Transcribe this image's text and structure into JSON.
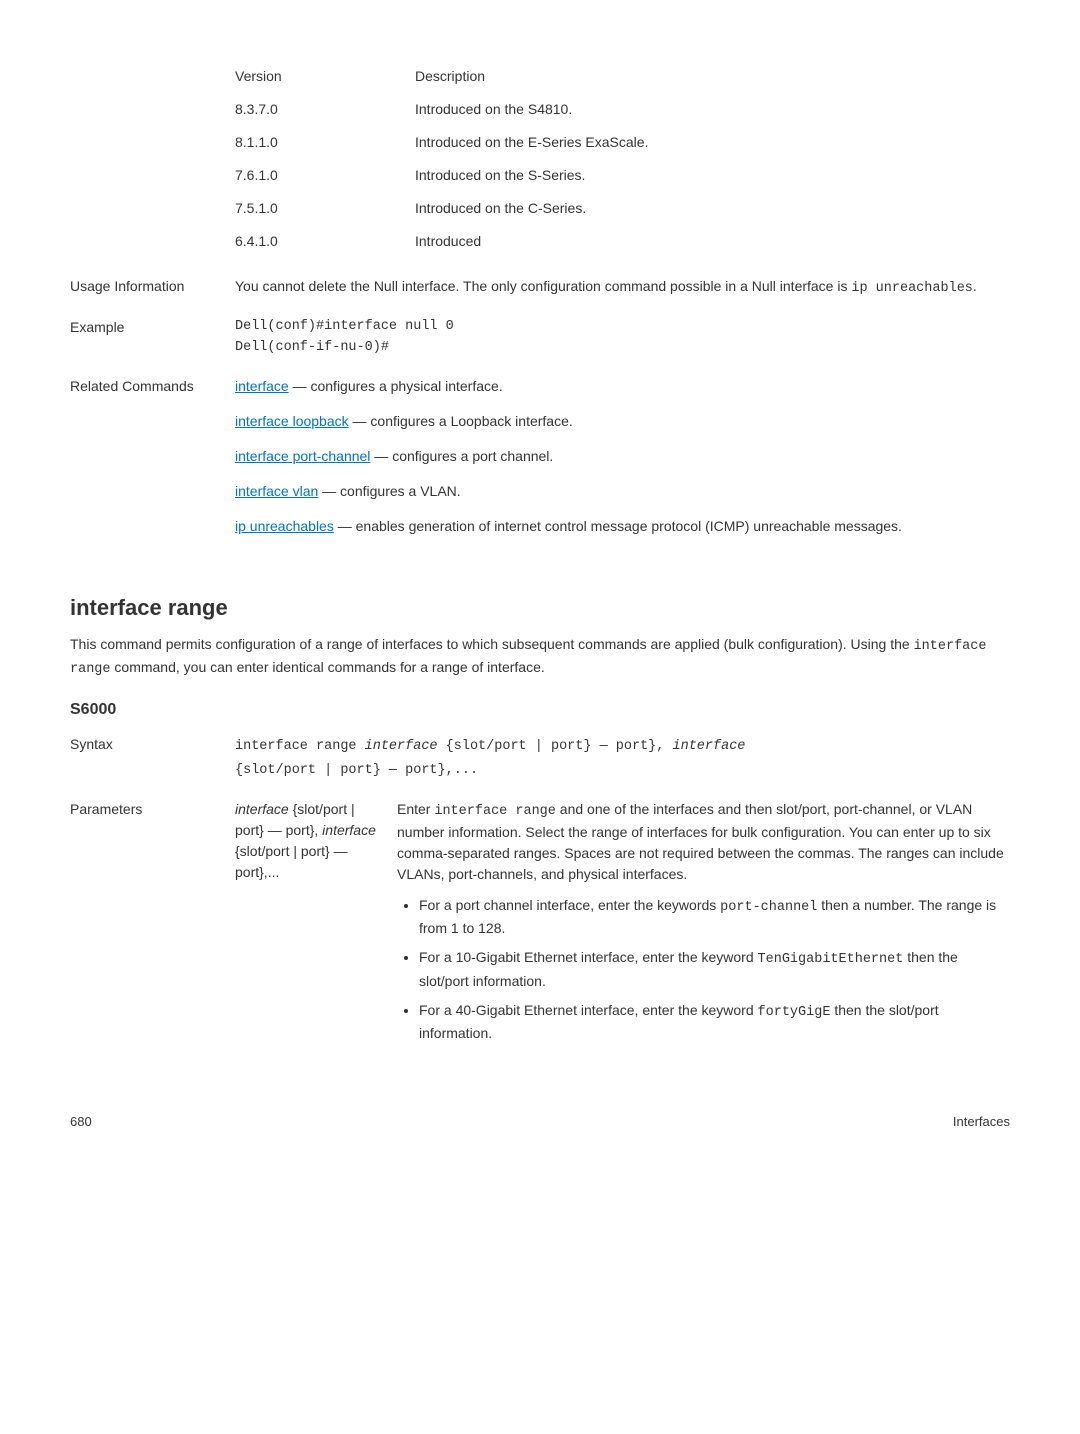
{
  "versionTable": {
    "header": {
      "col1": "Version",
      "col2": "Description"
    },
    "rows": [
      {
        "v": "8.3.7.0",
        "d": "Introduced on the S4810."
      },
      {
        "v": "8.1.1.0",
        "d": "Introduced on the E-Series ExaScale."
      },
      {
        "v": "7.6.1.0",
        "d": "Introduced on the S-Series."
      },
      {
        "v": "7.5.1.0",
        "d": "Introduced on the C-Series."
      },
      {
        "v": "6.4.1.0",
        "d": "Introduced"
      }
    ]
  },
  "usage": {
    "label": "Usage Information",
    "text_1": "You cannot delete the Null interface. The only configuration command possible in a Null interface is ",
    "text_code": "ip unreachables",
    "text_2": "."
  },
  "example": {
    "label": "Example",
    "code": "Dell(conf)#interface null 0\nDell(conf-if-nu-0)#"
  },
  "related": {
    "label": "Related Commands",
    "items": [
      {
        "link": "interface",
        "rest": " — configures a physical interface."
      },
      {
        "link": "interface loopback",
        "rest": " — configures a Loopback interface."
      },
      {
        "link": "interface port-channel",
        "rest": " — configures a port channel."
      },
      {
        "link": "interface vlan",
        "rest": " — configures a VLAN."
      },
      {
        "link": "ip unreachables",
        "rest": " — enables generation of internet control message protocol (ICMP) unreachable messages."
      }
    ]
  },
  "heading2": "interface range",
  "intro_1": "This command permits configuration of a range of interfaces to which subsequent commands are applied (bulk configuration). Using the ",
  "intro_code": "interface range",
  "intro_2": " command, you can enter identical commands for a range of interface.",
  "heading3": "S6000",
  "syntax": {
    "label": "Syntax",
    "line1_a": "interface range ",
    "line1_b": "interface",
    "line1_c": " {slot/port | port} — port}, ",
    "line1_d": "interface",
    "line2": "{slot/port | port} — port},..."
  },
  "params": {
    "label": "Parameters",
    "name_l1": "interface",
    "name_l1b": " {slot/",
    "name_l2": "port | port} — port}, ",
    "name_l2b": "interface",
    "name_l3": " {slot/port | port} — port},...",
    "desc_a": "Enter ",
    "desc_code": "interface range",
    "desc_b": " and one of the interfaces and then slot/port, port-channel, or VLAN number information. Select the range of interfaces for bulk configuration. You can enter up to six comma-separated ranges. Spaces are not required between the commas. The ranges can include VLANs, port-channels, and physical interfaces.",
    "bullets": [
      {
        "a": "For a port channel interface, enter the keywords ",
        "code": "port-channel",
        "b": " then a number. The range is from 1 to 128."
      },
      {
        "a": "For a 10-Gigabit Ethernet interface, enter the keyword ",
        "code": "TenGigabitEthernet",
        "b": " then the slot/port information."
      },
      {
        "a": "For a 40-Gigabit Ethernet interface, enter the keyword ",
        "code": "fortyGigE",
        "b": " then the slot/port information."
      }
    ]
  },
  "footer": {
    "page": "680",
    "section": "Interfaces"
  }
}
